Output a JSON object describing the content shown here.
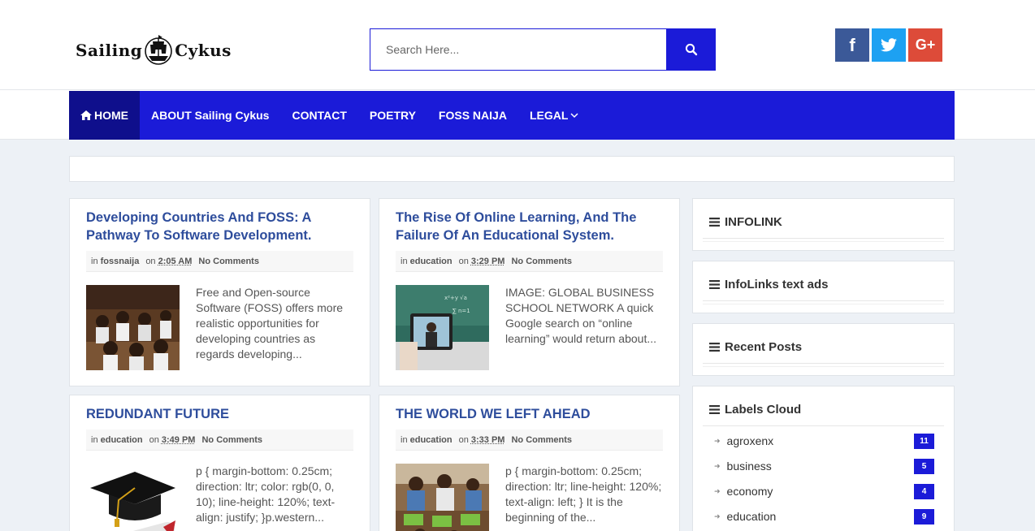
{
  "header": {
    "logo_left": "Sailing",
    "logo_right": "Cykus",
    "search_placeholder": "Search Here...",
    "social": [
      {
        "label": "f",
        "color": "#3b5998"
      },
      {
        "label": "twitter",
        "color": "#1da1f2"
      },
      {
        "label": "G+",
        "color": "#dd4b39"
      }
    ]
  },
  "nav": {
    "items": [
      {
        "label": "HOME",
        "icon": "home-icon",
        "active": true
      },
      {
        "label": "ABOUT Sailing Cykus"
      },
      {
        "label": "CONTACT"
      },
      {
        "label": "POETRY"
      },
      {
        "label": "FOSS NAIJA"
      },
      {
        "label": "LEGAL",
        "icon": "chevron-down-icon"
      }
    ]
  },
  "posts": [
    {
      "title": "Developing Countries And FOSS: A Pathway To Software Development.",
      "label_prefix": "in",
      "label": "fossnaija",
      "time_prefix": "on",
      "time": "2:05 AM",
      "comments": "No Comments",
      "excerpt": "Free and Open-source Software (FOSS) offers more realistic opportunities for developing countries as regards developing..."
    },
    {
      "title": "The Rise Of Online Learning, And The Failure Of An Educational System.",
      "label_prefix": "in",
      "label": "education",
      "time_prefix": "on",
      "time": "3:29 PM",
      "comments": "No Comments",
      "excerpt": "IMAGE: GLOBAL BUSINESS SCHOOL NETWORK A quick Google search on “online learning” would return about..."
    },
    {
      "title": "REDUNDANT FUTURE",
      "label_prefix": "in",
      "label": "education",
      "time_prefix": "on",
      "time": "3:49 PM",
      "comments": "No Comments",
      "excerpt": "p { margin-bottom: 0.25cm; direction: ltr; color: rgb(0, 0, 10); line-height: 120%; text-align: justify; }p.western..."
    },
    {
      "title": "THE WORLD WE LEFT AHEAD",
      "label_prefix": "in",
      "label": "education",
      "time_prefix": "on",
      "time": "3:33 PM",
      "comments": "No Comments",
      "excerpt": "p { margin-bottom: 0.25cm; direction: ltr; line-height: 120%; text-align: left; } It is the beginning of the..."
    }
  ],
  "sidebar": {
    "widgets": [
      {
        "title": "INFOLINK"
      },
      {
        "title": "InfoLinks text ads"
      },
      {
        "title": "Recent Posts"
      },
      {
        "title": "Labels Cloud"
      }
    ],
    "labels": [
      {
        "name": "agroxenx",
        "count": "11"
      },
      {
        "name": "business",
        "count": "5"
      },
      {
        "name": "economy",
        "count": "4"
      },
      {
        "name": "education",
        "count": "9"
      }
    ]
  },
  "colors": {
    "accent": "#1b1bd8",
    "nav_active": "#0f0f8c",
    "title": "#2e4d9c"
  }
}
